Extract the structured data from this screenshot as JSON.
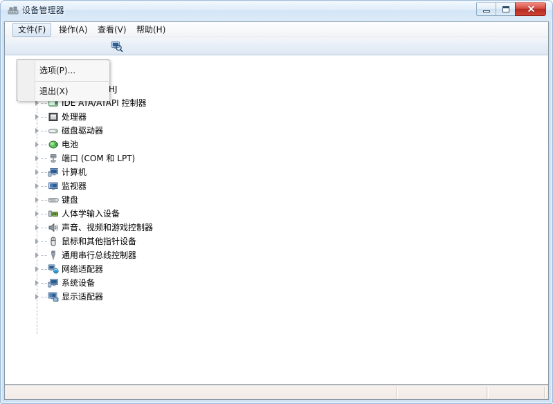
{
  "window": {
    "title": "设备管理器",
    "icon": "device-manager-icon",
    "controls": {
      "minimize": "最小化",
      "maximize": "最大化",
      "close": "关闭",
      "close_glyph": "✕"
    }
  },
  "menubar": {
    "items": [
      {
        "label": "文件(F)",
        "active": true
      },
      {
        "label": "操作(A)",
        "active": false
      },
      {
        "label": "查看(V)",
        "active": false
      },
      {
        "label": "帮助(H)",
        "active": false
      }
    ]
  },
  "file_menu": {
    "open": true,
    "items": [
      {
        "label": "选项(P)...",
        "name": "menu-item-options"
      },
      {
        "label": "退出(X)",
        "name": "menu-item-exit"
      }
    ]
  },
  "toolbar": {
    "buttons": [
      {
        "name": "scan-hardware-changes-icon",
        "label": "扫描检测硬件改动"
      }
    ]
  },
  "tree": {
    "root": {
      "label": "HJ",
      "truncated": true
    },
    "items": [
      {
        "label": "IDE ATA/ATAPI 控制器",
        "icon": "ide-controller-icon"
      },
      {
        "label": "处理器",
        "icon": "processor-icon"
      },
      {
        "label": "磁盘驱动器",
        "icon": "disk-drive-icon"
      },
      {
        "label": "电池",
        "icon": "battery-icon"
      },
      {
        "label": "端口 (COM 和 LPT)",
        "icon": "ports-icon"
      },
      {
        "label": "计算机",
        "icon": "computer-icon"
      },
      {
        "label": "监视器",
        "icon": "monitor-icon"
      },
      {
        "label": "键盘",
        "icon": "keyboard-icon"
      },
      {
        "label": "人体学输入设备",
        "icon": "hid-icon"
      },
      {
        "label": "声音、视频和游戏控制器",
        "icon": "sound-icon"
      },
      {
        "label": "鼠标和其他指针设备",
        "icon": "mouse-icon"
      },
      {
        "label": "通用串行总线控制器",
        "icon": "usb-icon"
      },
      {
        "label": "网络适配器",
        "icon": "network-adapter-icon"
      },
      {
        "label": "系统设备",
        "icon": "system-devices-icon"
      },
      {
        "label": "显示适配器",
        "icon": "display-adapter-icon"
      }
    ]
  },
  "statusbar": {
    "text": "",
    "panel2": "",
    "panel3": ""
  },
  "colors": {
    "titlebar_top": "#f2f8fd",
    "frame": "#cfe2f4",
    "close_button": "#cf4236",
    "status_bg": "#f3ebe7",
    "menu_bg": "#f7f7f7"
  }
}
